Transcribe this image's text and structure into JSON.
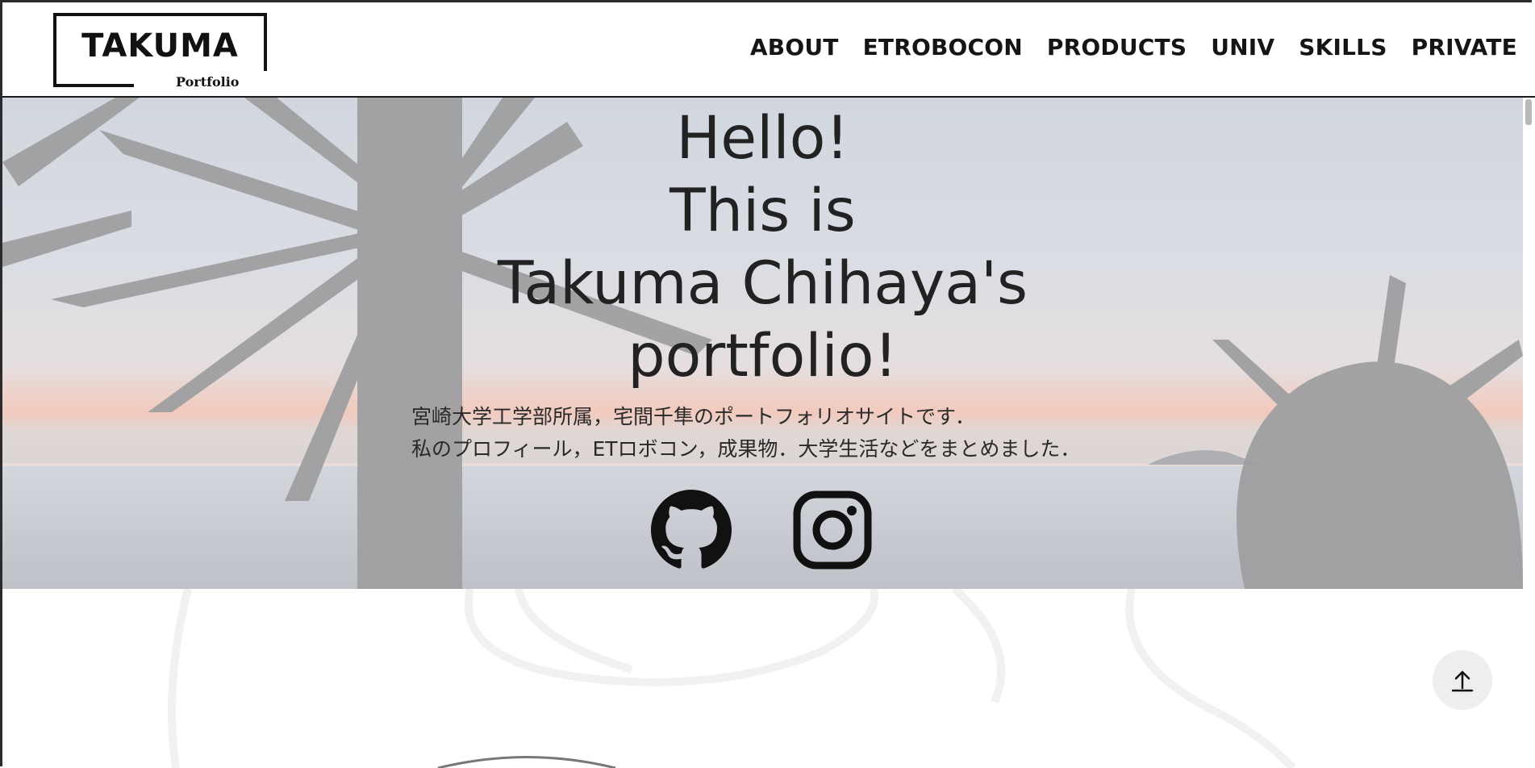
{
  "header": {
    "logo": {
      "title": "TAKUMA",
      "subtitle": "Portfolio"
    },
    "nav": [
      "ABOUT",
      "ETROBOCON",
      "PRODUCTS",
      "UNIV",
      "SKILLS",
      "PRIVATE"
    ]
  },
  "hero": {
    "title_lines": [
      "Hello!",
      "This is",
      "Takuma Chihaya's",
      "portfolio!"
    ],
    "description_lines": [
      "宮崎大学工学部所属，宅間千隼のポートフォリオサイトです．",
      "私のプロフィール，ETロボコン，成果物．大学生活などをまとめました．"
    ],
    "social": [
      {
        "icon": "github-icon"
      },
      {
        "icon": "instagram-icon"
      }
    ]
  },
  "scroll_top": {
    "icon": "arrow-up-icon"
  },
  "colors": {
    "text": "#151515",
    "overlay": "rgba(255,255,255,0.55)",
    "button_bg": "#eeeeee"
  }
}
